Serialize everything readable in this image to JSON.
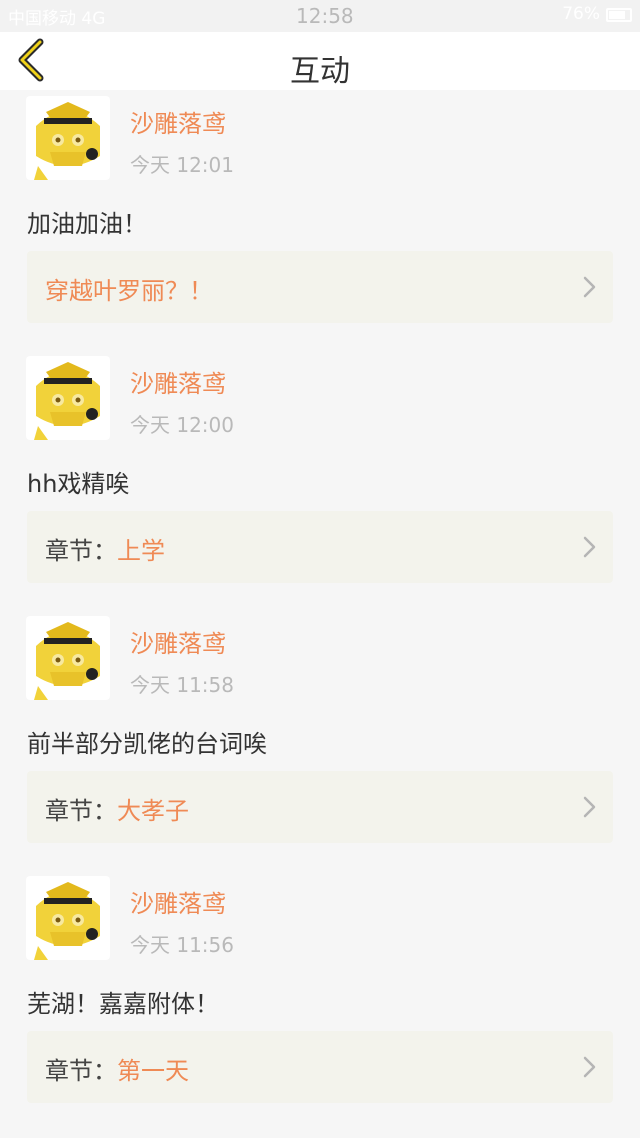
{
  "status": {
    "carrier": "中国移动 4G",
    "time": "12:58",
    "battery": "76%"
  },
  "header": {
    "title": "互动"
  },
  "colors": {
    "accent": "#ef8a55",
    "card_bg": "#f3f3ec",
    "page_bg": "#f6f6f6",
    "muted": "#b9b9b9"
  },
  "items": [
    {
      "user": "沙雕落鸢",
      "time": "今天 12:01",
      "comment": "加油加油！",
      "ref_prefix": "",
      "ref_value": "穿越叶罗丽？！"
    },
    {
      "user": "沙雕落鸢",
      "time": "今天 12:00",
      "comment": "hh戏精唉",
      "ref_prefix": "章节：",
      "ref_value": "上学"
    },
    {
      "user": "沙雕落鸢",
      "time": "今天 11:58",
      "comment": "前半部分凯佬的台词唉",
      "ref_prefix": "章节：",
      "ref_value": "大孝子"
    },
    {
      "user": "沙雕落鸢",
      "time": "今天 11:56",
      "comment": "芜湖！嘉嘉附体！",
      "ref_prefix": "章节：",
      "ref_value": "第一天"
    }
  ]
}
